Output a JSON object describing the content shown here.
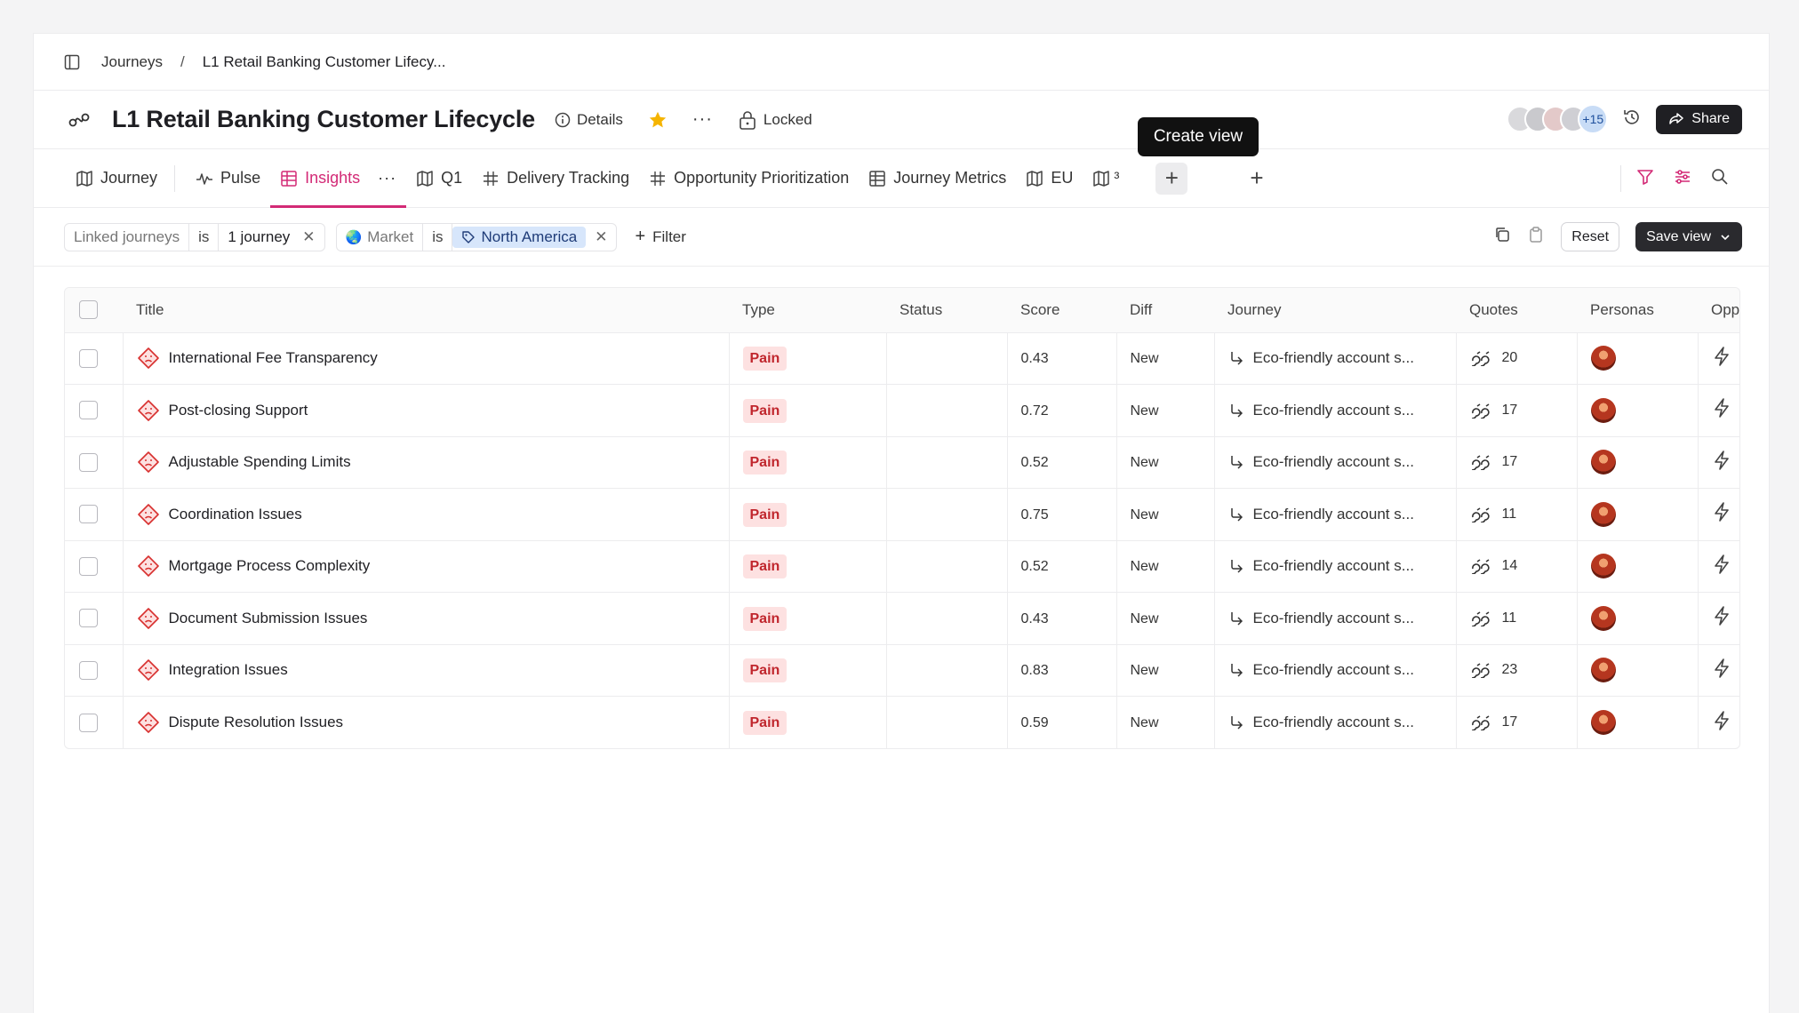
{
  "breadcrumb": {
    "root": "Journeys",
    "separator": "/",
    "current": "L1 Retail Banking Customer Lifecy..."
  },
  "header": {
    "title": "L1 Retail Banking Customer Lifecycle",
    "details_label": "Details",
    "locked_label": "Locked",
    "more_avatars": "+15",
    "share_label": "Share",
    "star_color": "#f5b400"
  },
  "tabs": [
    {
      "label": "Journey",
      "icon": "map-icon"
    },
    {
      "label": "Pulse",
      "icon": "pulse-icon"
    },
    {
      "label": "Insights",
      "icon": "table-icon",
      "active": true
    },
    {
      "label": "Q1",
      "icon": "map-icon"
    },
    {
      "label": "Delivery Tracking",
      "icon": "grid-icon"
    },
    {
      "label": "Opportunity Prioritization",
      "icon": "grid-icon"
    },
    {
      "label": "Journey Metrics",
      "icon": "table-icon"
    },
    {
      "label": "EU",
      "icon": "map-icon"
    },
    {
      "label": "³",
      "icon": "map-icon"
    }
  ],
  "tooltip": "Create view",
  "accent_color": "#d32a76",
  "filters": [
    {
      "key": "Linked journeys",
      "op": "is",
      "value": "1 journey"
    },
    {
      "key": "Market",
      "op": "is",
      "value": "North America"
    }
  ],
  "filter_add_label": "Filter",
  "reset_label": "Reset",
  "save_view_label": "Save view",
  "table": {
    "columns": [
      "Title",
      "Type",
      "Status",
      "Score",
      "Diff",
      "Journey",
      "Quotes",
      "Personas",
      "Opp"
    ],
    "rows": [
      {
        "title": "International Fee Transparency",
        "type": "Pain",
        "status": "",
        "score": "0.43",
        "diff": "New",
        "journey": "Eco-friendly account s...",
        "quotes": "20"
      },
      {
        "title": "Post-closing Support",
        "type": "Pain",
        "status": "",
        "score": "0.72",
        "diff": "New",
        "journey": "Eco-friendly account s...",
        "quotes": "17"
      },
      {
        "title": "Adjustable Spending Limits",
        "type": "Pain",
        "status": "",
        "score": "0.52",
        "diff": "New",
        "journey": "Eco-friendly account s...",
        "quotes": "17"
      },
      {
        "title": "Coordination Issues",
        "type": "Pain",
        "status": "",
        "score": "0.75",
        "diff": "New",
        "journey": "Eco-friendly account s...",
        "quotes": "11"
      },
      {
        "title": "Mortgage Process Complexity",
        "type": "Pain",
        "status": "",
        "score": "0.52",
        "diff": "New",
        "journey": "Eco-friendly account s...",
        "quotes": "14"
      },
      {
        "title": "Document Submission Issues",
        "type": "Pain",
        "status": "",
        "score": "0.43",
        "diff": "New",
        "journey": "Eco-friendly account s...",
        "quotes": "11"
      },
      {
        "title": "Integration Issues",
        "type": "Pain",
        "status": "",
        "score": "0.83",
        "diff": "New",
        "journey": "Eco-friendly account s...",
        "quotes": "23"
      },
      {
        "title": "Dispute Resolution Issues",
        "type": "Pain",
        "status": "",
        "score": "0.59",
        "diff": "New",
        "journey": "Eco-friendly account s...",
        "quotes": "17"
      }
    ]
  }
}
